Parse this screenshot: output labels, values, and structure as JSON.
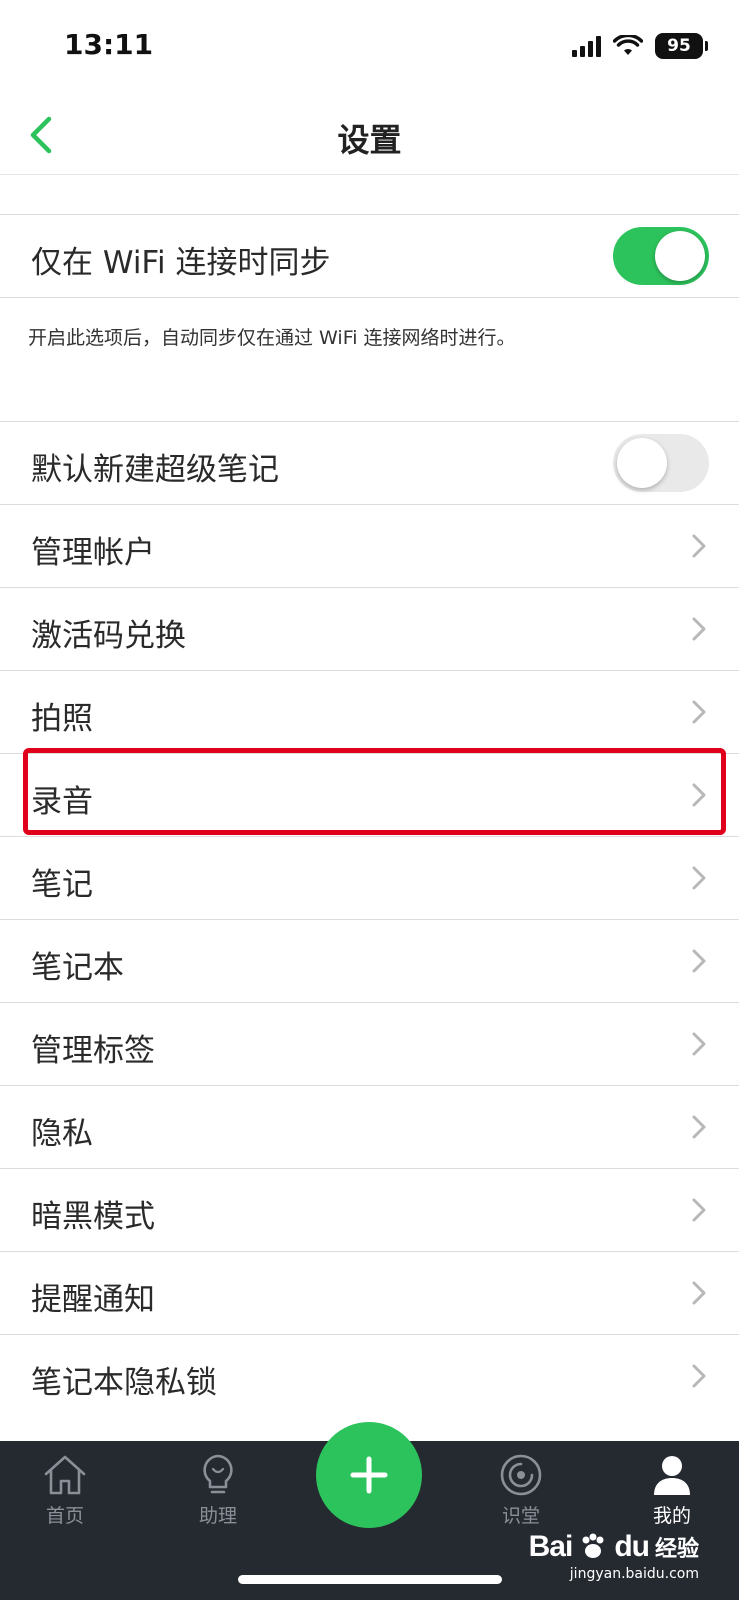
{
  "status_bar": {
    "time": "13:11",
    "battery": "95"
  },
  "nav": {
    "title": "设置"
  },
  "sync_wifi": {
    "label": "仅在 WiFi 连接时同步",
    "enabled": true,
    "description": "开启此选项后，自动同步仅在通过 WiFi 连接网络时进行。"
  },
  "super_note": {
    "label": "默认新建超级笔记",
    "enabled": false
  },
  "menu_items": [
    {
      "label": "管理帐户"
    },
    {
      "label": "激活码兑换"
    },
    {
      "label": "拍照"
    },
    {
      "label": "录音"
    },
    {
      "label": "笔记"
    },
    {
      "label": "笔记本"
    },
    {
      "label": "管理标签"
    },
    {
      "label": "隐私"
    },
    {
      "label": "暗黑模式"
    },
    {
      "label": "提醒通知"
    },
    {
      "label": "笔记本隐私锁"
    }
  ],
  "tabs": [
    {
      "label": "首页"
    },
    {
      "label": "助理"
    },
    {
      "label": "识堂"
    },
    {
      "label": "我的"
    }
  ],
  "watermark": {
    "brand": "Bai",
    "brand_suffix": "du",
    "cn": "经验",
    "url": "jingyan.baidu.com"
  },
  "colors": {
    "accent": "#2dc35c",
    "highlight": "#e0001b",
    "tab_bar": "#252a31"
  }
}
